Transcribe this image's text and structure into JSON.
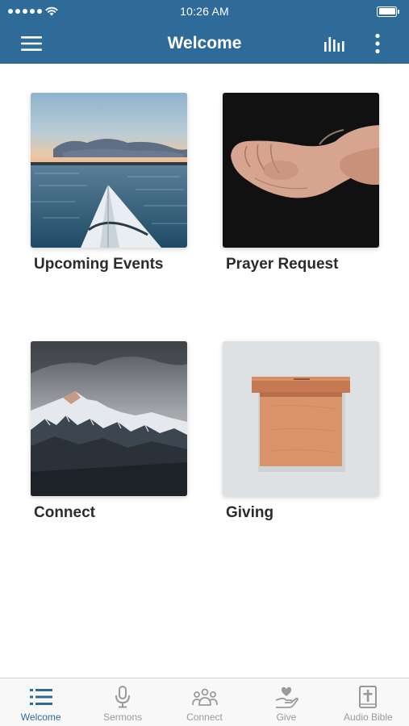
{
  "status_bar": {
    "time": "10:26 AM"
  },
  "header": {
    "title": "Welcome",
    "background_color": "#2f6b98",
    "left_icon": "hamburger-menu-icon",
    "right_icons": [
      "audio-levels-icon",
      "more-vertical-icon"
    ]
  },
  "tiles": [
    {
      "label": "Upcoming Events",
      "image": "kayak-on-lake-at-sunset"
    },
    {
      "label": "Prayer Request",
      "image": "open-hands-on-black"
    },
    {
      "label": "Connect",
      "image": "snowy-mountain-range"
    },
    {
      "label": "Giving",
      "image": "wooden-donation-box"
    }
  ],
  "tab_bar": {
    "active_index": 0,
    "active_color": "#2f6b98",
    "inactive_color": "#9a9a9a",
    "items": [
      {
        "label": "Welcome",
        "icon": "list-icon"
      },
      {
        "label": "Sermons",
        "icon": "microphone-icon"
      },
      {
        "label": "Connect",
        "icon": "group-icon"
      },
      {
        "label": "Give",
        "icon": "heart-hand-icon"
      },
      {
        "label": "Audio Bible",
        "icon": "bible-cross-icon"
      }
    ]
  }
}
